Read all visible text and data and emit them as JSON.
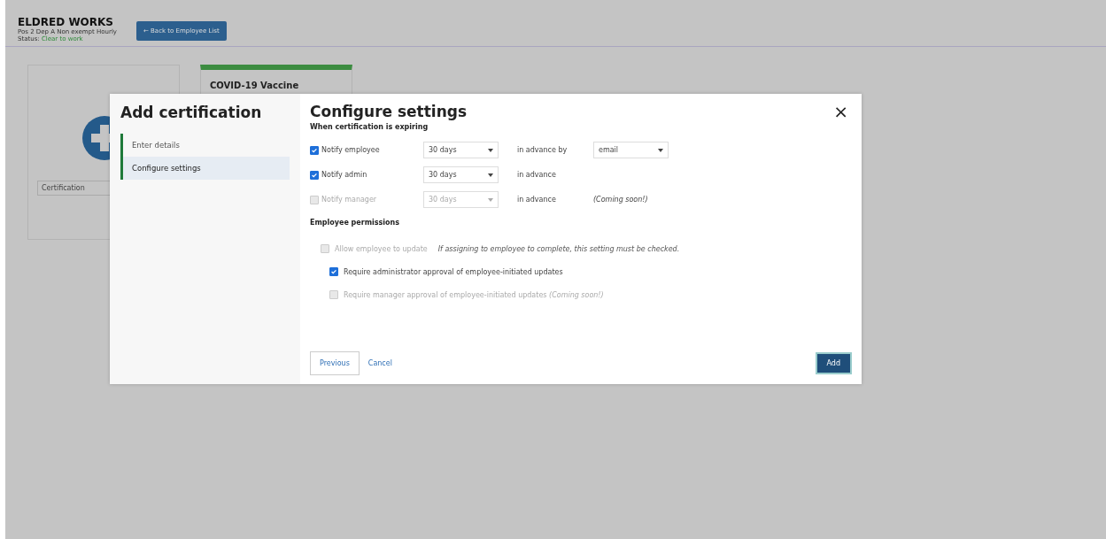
{
  "header": {
    "name": "ELDRED WORKS",
    "position": "Pos 2 Dep A Non exempt Hourly",
    "status_label": "Status:",
    "status": "Clear to work",
    "back_button": "← Back to Employee List"
  },
  "cards": [
    {
      "kind": "add",
      "field_value": "Certification"
    },
    {
      "kind": "cert",
      "title": "COVID-19 Vaccine"
    }
  ],
  "modal": {
    "title": "Add certification",
    "steps": [
      {
        "label": "Enter details",
        "selected": false
      },
      {
        "label": "Configure settings",
        "selected": true
      }
    ],
    "heading": "Configure settings",
    "close": "×",
    "section1": "When certification is expiring",
    "notify": [
      {
        "label": "Notify employee",
        "checked": true,
        "disabled": false,
        "period": "30 days",
        "suffix": "in advance by",
        "method": "email"
      },
      {
        "label": "Notify admin",
        "checked": true,
        "disabled": false,
        "period": "30 days",
        "suffix": "in advance"
      },
      {
        "label": "Notify manager",
        "checked": false,
        "disabled": true,
        "period": "30 days",
        "suffix": "in advance",
        "note": "(Coming soon!)"
      }
    ],
    "section2": "Employee permissions",
    "permissions": [
      {
        "label": "Allow employee to update",
        "hint": "If assigning to employee to complete, this setting must be checked.",
        "checked": false,
        "disabled": true,
        "children": [
          {
            "label": "Require administrator approval of employee-initiated updates",
            "checked": true,
            "disabled": false
          },
          {
            "label": "Require manager approval of employee-initiated updates *(Coming soon!)*",
            "checked": false,
            "disabled": true
          }
        ]
      }
    ],
    "previous": "Previous",
    "cancel": "Cancel",
    "add": "Add"
  }
}
